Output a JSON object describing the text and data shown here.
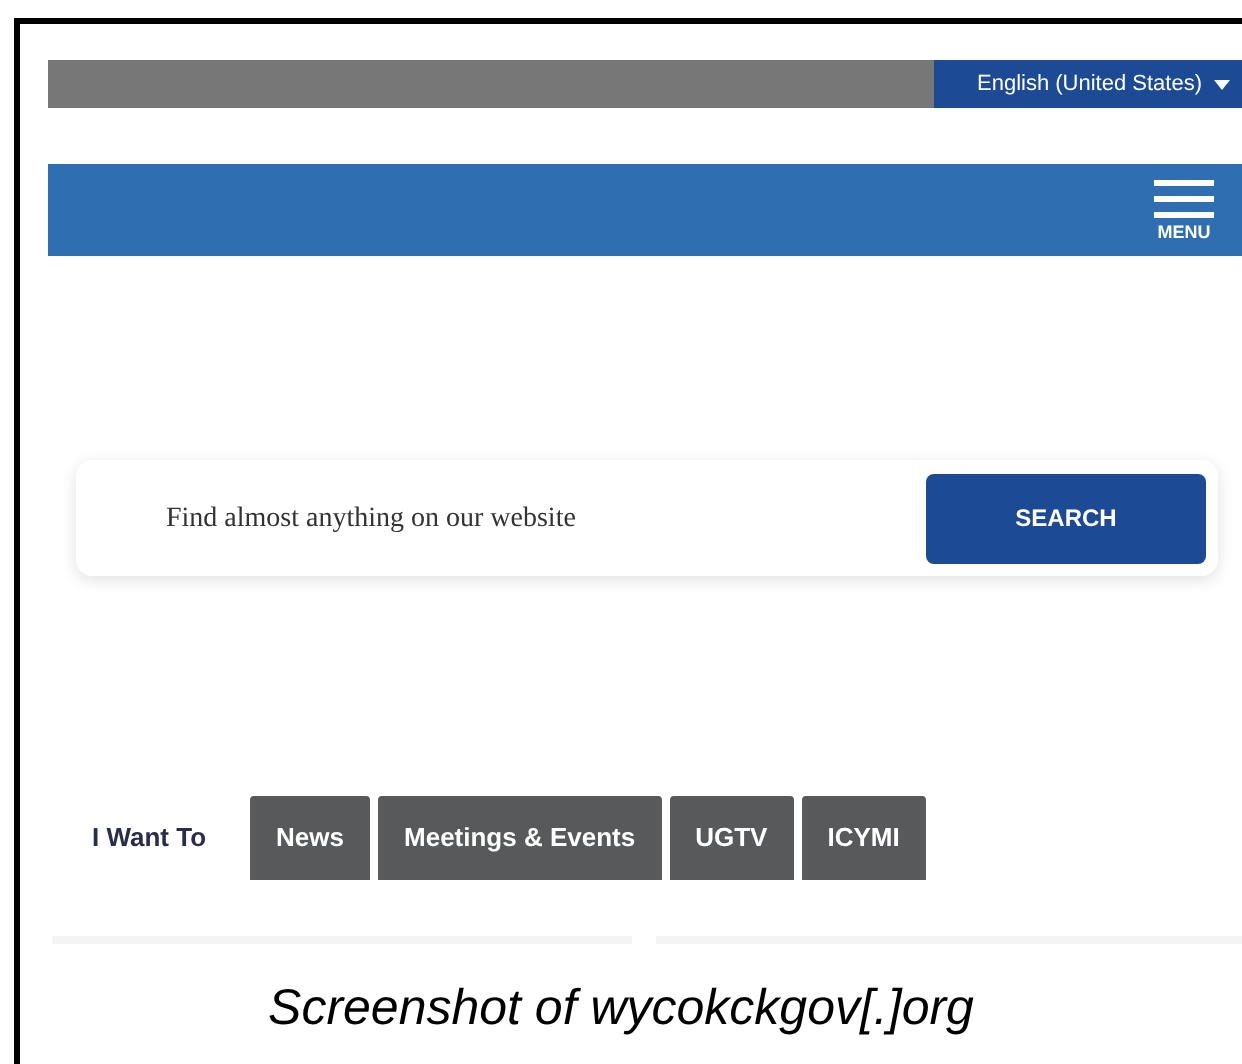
{
  "language_select": {
    "value": "English (United States)"
  },
  "nav": {
    "menu_label": "MENU"
  },
  "search": {
    "placeholder": "Find almost anything on our website",
    "button": "SEARCH"
  },
  "tabs": [
    {
      "label": "I Want To",
      "selected": true
    },
    {
      "label": "News",
      "selected": false
    },
    {
      "label": "Meetings & Events",
      "selected": false
    },
    {
      "label": "UGTV",
      "selected": false
    },
    {
      "label": "ICYMI",
      "selected": false
    }
  ],
  "caption": "Screenshot of wycokckgov[.]org"
}
